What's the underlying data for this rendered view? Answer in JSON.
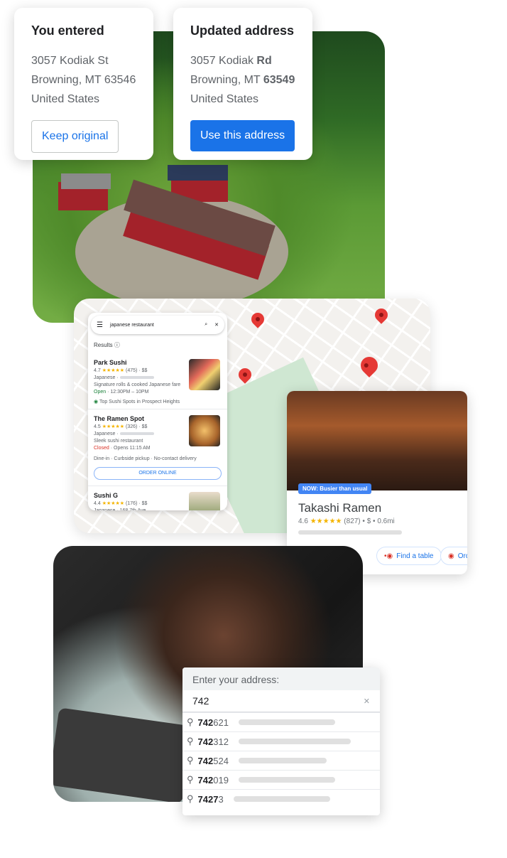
{
  "entered": {
    "title": "You entered",
    "line1": "3057 Kodiak St",
    "line2": "Browning, MT 63546",
    "line3": "United States",
    "button": "Keep original"
  },
  "updated": {
    "title": "Updated address",
    "street_a": "3057 Kodiak ",
    "street_b": "Rd",
    "city_a": "Browning, MT ",
    "city_b": "63549",
    "country": "United States",
    "button": "Use this address"
  },
  "maps": {
    "query": "japanese restaurant",
    "results_label": "Results",
    "results": [
      {
        "name": "Park Sushi",
        "rating": "4.7",
        "stars": "★★★★★",
        "count": "(475) · $$",
        "type": "Japanese ·",
        "desc": "Signature rolls & cooked Japanese fare",
        "status": "Open",
        "hours": " · 12:30PM – 10PM",
        "tag": "Top Sushi Spots in Prospect Heights"
      },
      {
        "name": "The Ramen Spot",
        "rating": "4.5",
        "stars": "★★★★★",
        "count": "(326) · $$",
        "type": "Japanese ·",
        "desc": "Sleek sushi restaurant",
        "status": "Closed",
        "hours": " · Opens 11:15 AM",
        "services": "Dine-in · Curbside pickup · No-contact delivery",
        "button": "ORDER ONLINE"
      },
      {
        "name": "Sushi G",
        "rating": "4.4",
        "stars": "★★★★★",
        "count": "(176) · $$",
        "type": "Japanese · 168 7th Ave"
      }
    ]
  },
  "place": {
    "badge": "NOW: Busier than usual",
    "name": "Takashi Ramen",
    "rating": "4.6",
    "stars": "★★★★★",
    "meta": "(827) • $ • 0.6mi",
    "find_table": "Find a table",
    "order": "Order"
  },
  "autocomplete": {
    "label": "Enter your address:",
    "value": "742",
    "suggestions": [
      {
        "bold": "742",
        "rest": "621"
      },
      {
        "bold": "742",
        "rest": "312"
      },
      {
        "bold": "742",
        "rest": "524"
      },
      {
        "bold": "742",
        "rest": "019"
      },
      {
        "bold": "7427",
        "rest": "3"
      }
    ]
  },
  "colors": {
    "primary": "#1a73e8",
    "star": "#f4b400",
    "pin": "#e53935",
    "open": "#188038",
    "closed": "#d93025"
  }
}
